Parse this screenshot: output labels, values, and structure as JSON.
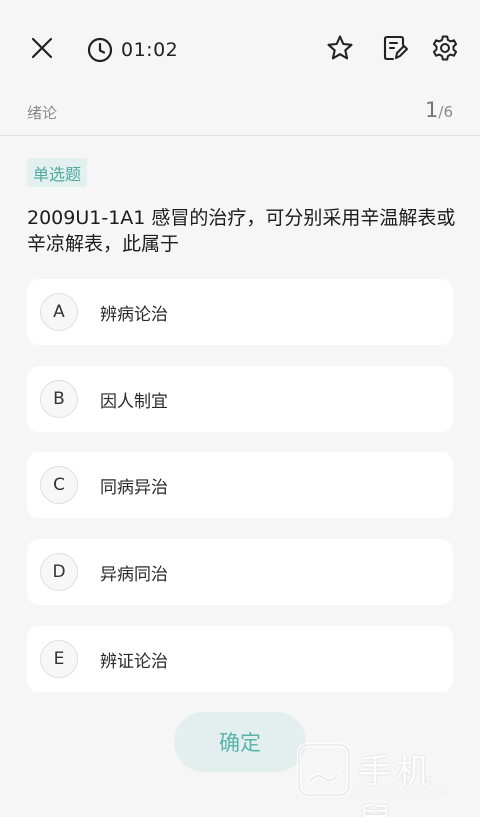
{
  "header": {
    "timer": "01:02",
    "icons": [
      "close-icon",
      "clock-icon",
      "star-icon",
      "edit-icon",
      "gear-icon"
    ]
  },
  "subheader": {
    "chapter": "绪论",
    "current": "1",
    "separator": "/",
    "total": "6"
  },
  "question": {
    "type": "单选题",
    "text": "2009U1-1A1 感冒的治疗，可分别采用辛温解表或辛凉解表，此属于",
    "options": [
      {
        "letter": "A",
        "text": "辨病论治"
      },
      {
        "letter": "B",
        "text": "因人制宜"
      },
      {
        "letter": "C",
        "text": "同病异治"
      },
      {
        "letter": "D",
        "text": "异病同治"
      },
      {
        "letter": "E",
        "text": "辨证论治"
      }
    ]
  },
  "confirm_label": "确定",
  "watermark": {
    "title": "手机鼠",
    "subtitle": "SHOUJISHU.COM"
  },
  "colors": {
    "accent": "#5bb3aa",
    "accent_bg": "#e3efee",
    "background": "#f6f6f6",
    "card": "#ffffff"
  }
}
